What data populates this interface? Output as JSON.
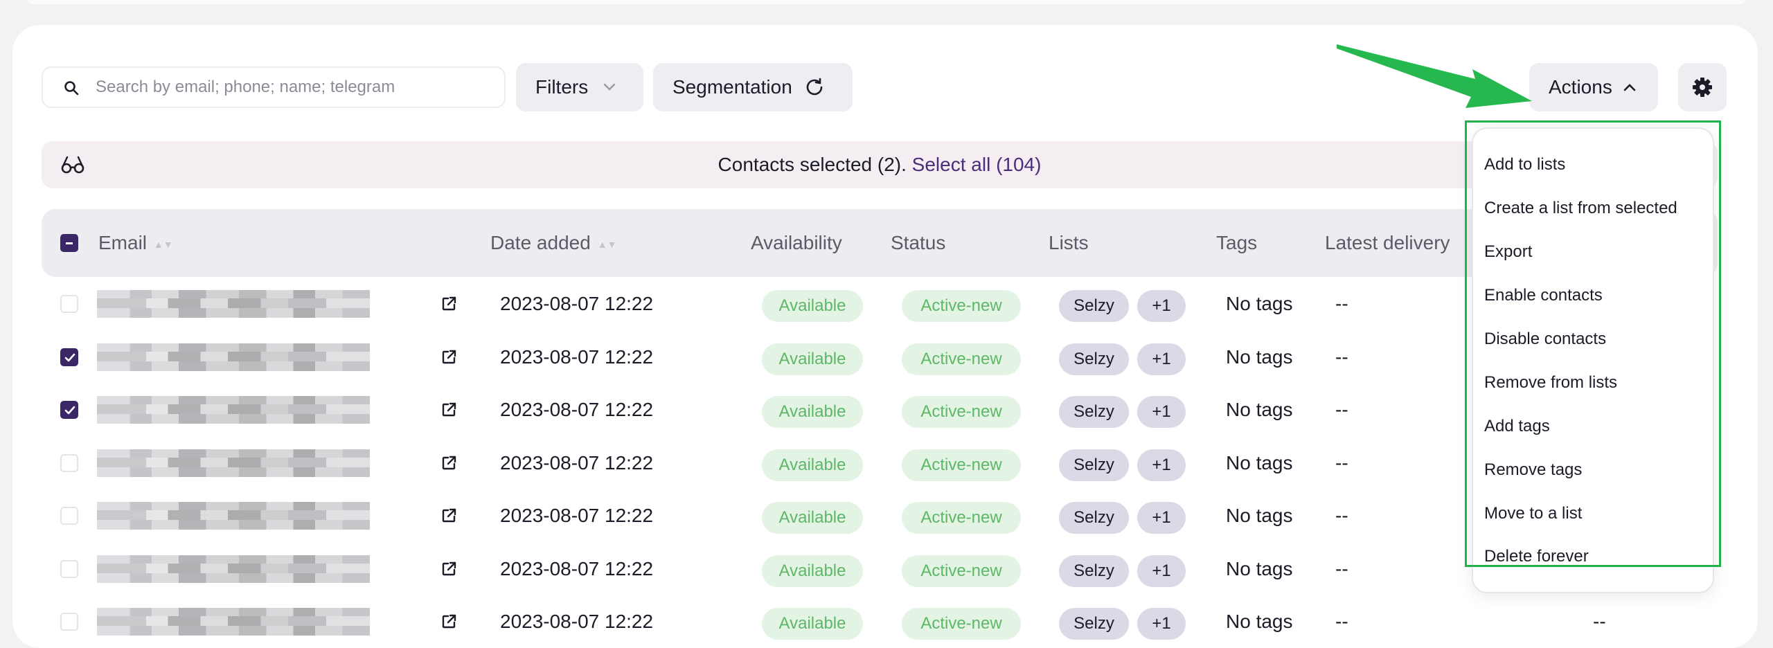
{
  "search": {
    "placeholder": "Search by email; phone; name; telegram"
  },
  "toolbar": {
    "filters_label": "Filters",
    "segmentation_label": "Segmentation",
    "actions_label": "Actions"
  },
  "selection": {
    "selected_text": "Contacts selected (2). ",
    "select_all_text": "Select all (104)"
  },
  "table": {
    "columns": {
      "email": "Email",
      "date_added": "Date added",
      "availability": "Availability",
      "status": "Status",
      "lists": "Lists",
      "tags": "Tags",
      "latest_delivery": "Latest delivery"
    },
    "rows": [
      {
        "checked": false,
        "date": "2023-08-07 12:22",
        "availability": "Available",
        "status": "Active-new",
        "list": "Selzy",
        "more_lists": "+1",
        "tags": "No tags",
        "latest_delivery": "--"
      },
      {
        "checked": true,
        "date": "2023-08-07 12:22",
        "availability": "Available",
        "status": "Active-new",
        "list": "Selzy",
        "more_lists": "+1",
        "tags": "No tags",
        "latest_delivery": "--"
      },
      {
        "checked": true,
        "date": "2023-08-07 12:22",
        "availability": "Available",
        "status": "Active-new",
        "list": "Selzy",
        "more_lists": "+1",
        "tags": "No tags",
        "latest_delivery": "--"
      },
      {
        "checked": false,
        "date": "2023-08-07 12:22",
        "availability": "Available",
        "status": "Active-new",
        "list": "Selzy",
        "more_lists": "+1",
        "tags": "No tags",
        "latest_delivery": "--"
      },
      {
        "checked": false,
        "date": "2023-08-07 12:22",
        "availability": "Available",
        "status": "Active-new",
        "list": "Selzy",
        "more_lists": "+1",
        "tags": "No tags",
        "latest_delivery": "--"
      },
      {
        "checked": false,
        "date": "2023-08-07 12:22",
        "availability": "Available",
        "status": "Active-new",
        "list": "Selzy",
        "more_lists": "+1",
        "tags": "No tags",
        "latest_delivery": "--"
      },
      {
        "checked": false,
        "date": "2023-08-07 12:22",
        "availability": "Available",
        "status": "Active-new",
        "list": "Selzy",
        "more_lists": "+1",
        "tags": "No tags",
        "latest_delivery": "--",
        "extra": "--"
      }
    ]
  },
  "actions_menu": {
    "items": [
      "Add to lists",
      "Create a list from selected",
      "Export",
      "Enable contacts",
      "Disable contacts",
      "Remove from lists",
      "Add tags",
      "Remove tags",
      "Move to a list",
      "Delete forever"
    ]
  },
  "colors": {
    "accent_purple": "#3a2766",
    "badge_green_bg": "#e3f4e4",
    "badge_green_text": "#5db767",
    "highlight_green": "#22b24c"
  }
}
